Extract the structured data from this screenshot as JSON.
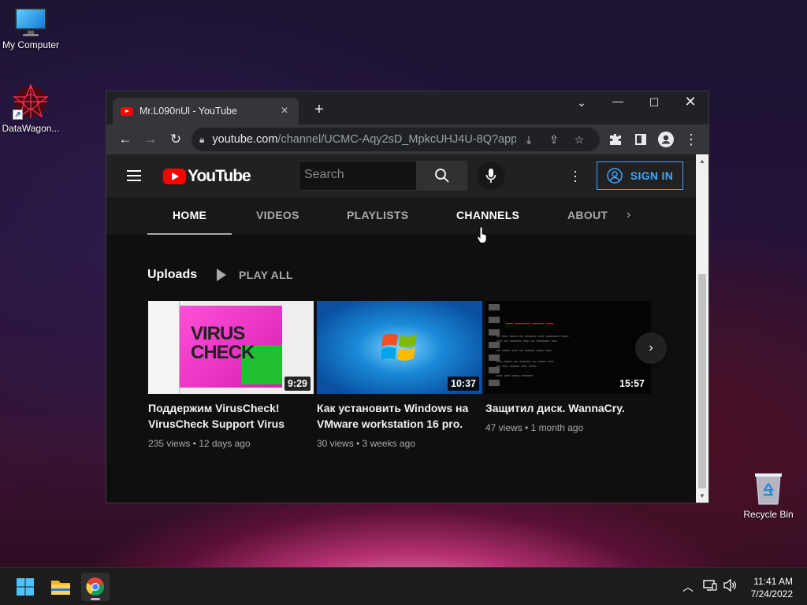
{
  "desktop": {
    "icons": [
      {
        "label": "My Computer"
      },
      {
        "label": "DataWagon..."
      },
      {
        "label": "Recycle Bin"
      }
    ]
  },
  "browser": {
    "tab_title": "Mr.L090nUl - YouTube",
    "url_host": "youtube.com",
    "url_path": "/channel/UCMC-Aqy2sD_MpkcUHJ4U-8Q?app..."
  },
  "youtube": {
    "logo_text": "YouTube",
    "search_placeholder": "Search",
    "sign_in": "SIGN IN",
    "channel_tabs": [
      "HOME",
      "VIDEOS",
      "PLAYLISTS",
      "CHANNELS",
      "ABOUT"
    ],
    "active_tab": "HOME",
    "section_title": "Uploads",
    "play_all": "PLAY ALL",
    "videos": [
      {
        "title_line1": "Поддержим VirusCheck!",
        "title_line2": "VirusCheck Support Virus",
        "duration": "9:29",
        "meta": "235 views • 12 days ago",
        "thumb_text1": "VIRUS",
        "thumb_text2": "CHECK"
      },
      {
        "title_line1": "Как установить Windows на",
        "title_line2": "VMware workstation 16 pro.",
        "duration": "10:37",
        "meta": "30 views • 3 weeks ago"
      },
      {
        "title_line1": "Защитил диск. WannaCry.",
        "title_line2": "",
        "duration": "15:57",
        "meta": "47 views • 1 month ago"
      }
    ]
  },
  "taskbar": {
    "time": "11:41 AM",
    "date": "7/24/2022"
  },
  "colors": {
    "youtube_red": "#ff0000",
    "signin_blue": "#3ea6ff",
    "page_bg": "#0f0f0f"
  }
}
